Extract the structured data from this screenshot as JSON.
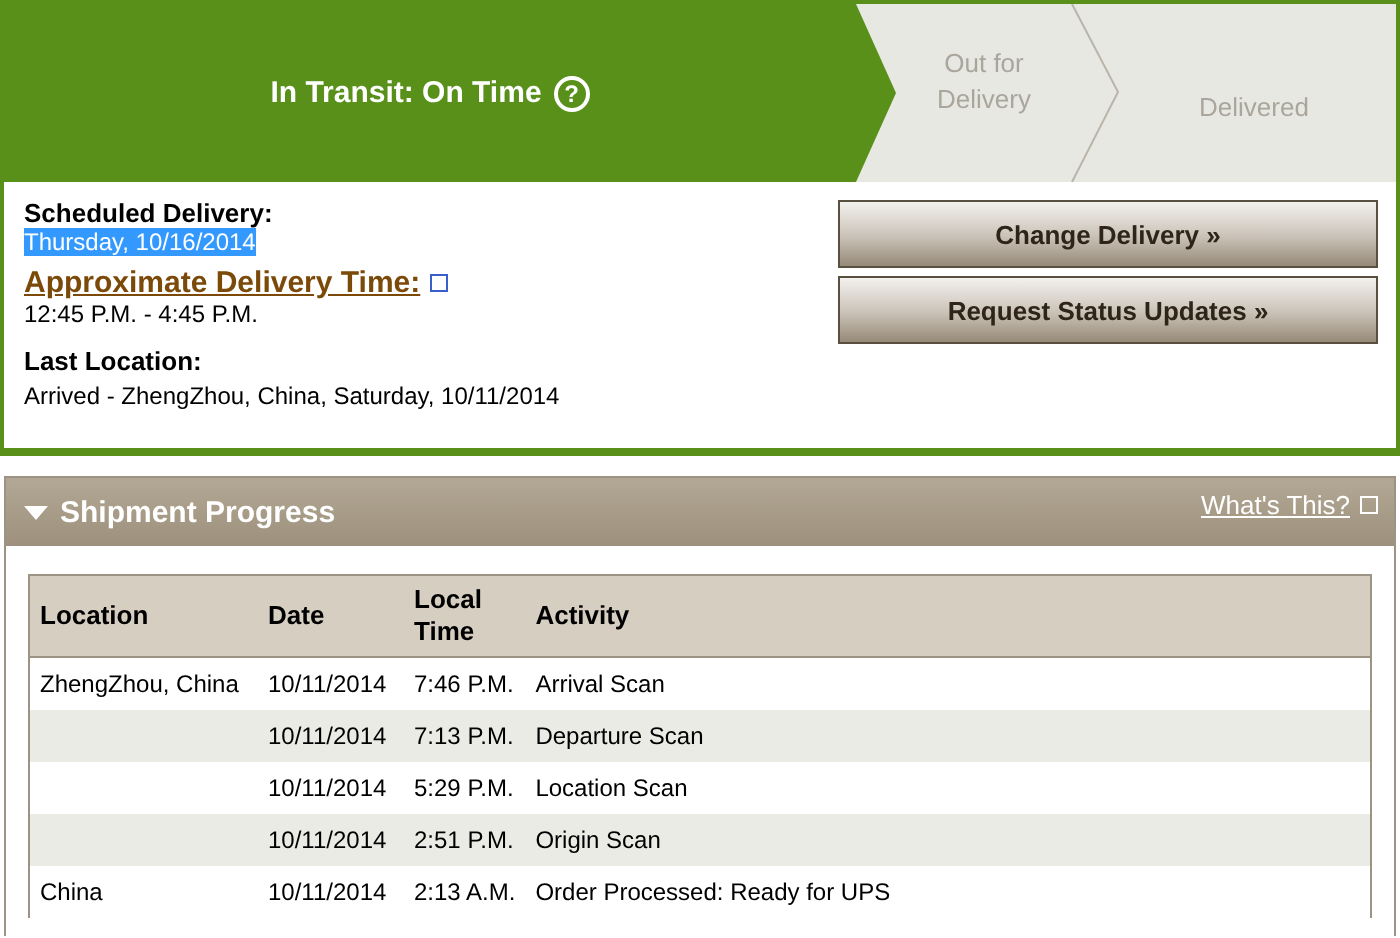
{
  "status_steps": [
    {
      "label": "In Transit: On Time",
      "selected": true,
      "help": "?"
    },
    {
      "label": "Out for Delivery",
      "selected": false
    },
    {
      "label": "Delivered",
      "selected": false
    }
  ],
  "details": {
    "scheduled_label": "Scheduled Delivery:",
    "scheduled_value": "Thursday, 10/16/2014",
    "scheduled_highlighted": true,
    "approx_label": "Approximate Delivery Time:",
    "approx_value": "12:45 P.M. - 4:45 P.M.",
    "last_location_label": "Last Location:",
    "last_location_value": "Arrived - ZhengZhou, China, Saturday, 10/11/2014"
  },
  "buttons": [
    "Change Delivery »",
    "Request Status Updates »"
  ],
  "shipment_progress": {
    "title": "Shipment Progress",
    "expanded": true,
    "help_link": "What's This?",
    "columns": [
      "Location",
      "Date",
      "Local Time",
      "Activity"
    ],
    "rows": [
      [
        "ZhengZhou, China",
        "10/11/2014",
        "7:46 P.M.",
        "Arrival Scan"
      ],
      [
        "",
        "10/11/2014",
        "7:13 P.M.",
        "Departure Scan"
      ],
      [
        "",
        "10/11/2014",
        "5:29 P.M.",
        "Location Scan"
      ],
      [
        "",
        "10/11/2014",
        "2:51 P.M.",
        "Origin Scan"
      ],
      [
        "China",
        "10/11/2014",
        "2:13 A.M.",
        "Order Processed: Ready for UPS"
      ]
    ]
  }
}
